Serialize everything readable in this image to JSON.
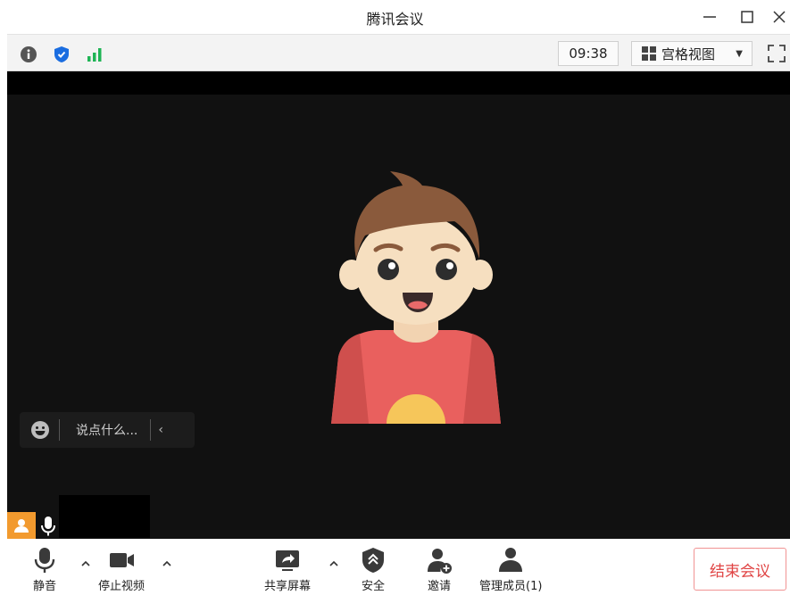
{
  "window": {
    "title": "腾讯会议"
  },
  "toolbar": {
    "time": "09:38",
    "view_label": "宫格视图",
    "icons": [
      "info-icon",
      "shield-icon",
      "signal-icon",
      "grid-icon",
      "fullscreen-icon"
    ]
  },
  "chat": {
    "placeholder": "说点什么..."
  },
  "controls": {
    "mute": "静音",
    "stop_video": "停止视频",
    "share_screen": "共享屏幕",
    "security": "安全",
    "invite": "邀请",
    "manage_members": "管理成员(1)",
    "end_meeting": "结束会议"
  },
  "colors": {
    "accent_green": "#1fb455",
    "accent_blue": "#1a6de0",
    "end_red": "#e04444",
    "participant_orange": "#f29a2e"
  }
}
